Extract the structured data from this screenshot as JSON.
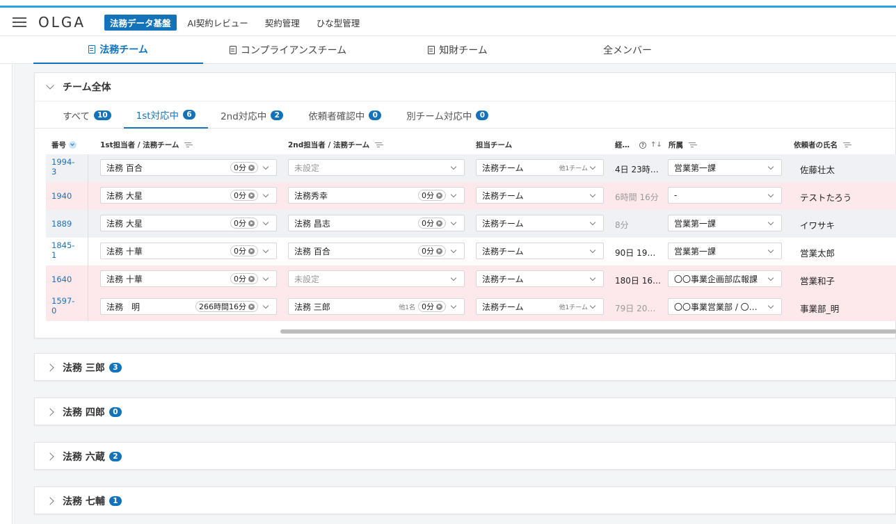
{
  "header": {
    "logo": "OLGA",
    "nav": [
      "法務データ基盤",
      "AI契約レビュー",
      "契約管理",
      "ひな型管理"
    ],
    "active_nav": 0
  },
  "team_tabs": [
    "法務チーム",
    "コンプライアンスチーム",
    "知財チーム",
    "全メンバー"
  ],
  "main_panel": {
    "title": "チーム全体",
    "status_tabs": [
      {
        "label": "すべて",
        "count": "10"
      },
      {
        "label": "1st対応中",
        "count": "6"
      },
      {
        "label": "2nd対応中",
        "count": "2"
      },
      {
        "label": "依頼者確認中",
        "count": "0"
      },
      {
        "label": "別チーム対応中",
        "count": "0"
      }
    ],
    "columns": {
      "id": "番号",
      "first": "1st担当者 / 法務チーム",
      "second": "2nd担当者 / 法務チーム",
      "team": "担当チーム",
      "elapsed": "経…",
      "dept": "所属",
      "requester": "依頼者の氏名"
    },
    "rows": [
      {
        "id": "1994-\n3",
        "first": "法務 百合",
        "first_time": "0分",
        "second": "未設定",
        "second_time": "",
        "second_extra": "",
        "team": "法務チーム",
        "team_extra": "他1チーム",
        "elapsed": "4日 23時…",
        "dept": "営業第一課",
        "requester": "佐藤壮太"
      },
      {
        "id": "1940",
        "first": "法務 大星",
        "first_time": "0分",
        "second": "法務秀幸",
        "second_time": "0分",
        "second_extra": "",
        "team": "法務チーム",
        "team_extra": "",
        "elapsed": "6時間 16分",
        "dept": "-",
        "requester": "テストたろう"
      },
      {
        "id": "1889",
        "first": "法務 大星",
        "first_time": "0分",
        "second": "法務 昌志",
        "second_time": "0分",
        "second_extra": "",
        "team": "法務チーム",
        "team_extra": "",
        "elapsed": "8分",
        "dept": "営業第一課",
        "requester": "イワサキ"
      },
      {
        "id": "1845-\n1",
        "first": "法務 十華",
        "first_time": "0分",
        "second": "法務 百合",
        "second_time": "0分",
        "second_extra": "",
        "team": "法務チーム",
        "team_extra": "",
        "elapsed": "90日 19…",
        "dept": "営業第一課",
        "requester": "営業太郎"
      },
      {
        "id": "1640",
        "first": "法務 十華",
        "first_time": "0分",
        "second": "未設定",
        "second_time": "",
        "second_extra": "",
        "team": "法務チーム",
        "team_extra": "",
        "elapsed": "180日 16…",
        "dept": "〇〇事業企画部広報課",
        "requester": "営業和子"
      },
      {
        "id": "1597-\n0",
        "first": "法務　明",
        "first_time": "266時間16分",
        "second": "法務 三郎",
        "second_time": "0分",
        "second_extra": "他1名",
        "team": "法務チーム",
        "team_extra": "他1チーム",
        "elapsed": "79日 20…",
        "dept": "〇〇事業営業部 / 〇…",
        "requester": "事業部_明"
      }
    ]
  },
  "collapsed_panels": [
    {
      "title": "法務 三郎",
      "count": "3"
    },
    {
      "title": "法務 四郎",
      "count": "0"
    },
    {
      "title": "法務 六蔵",
      "count": "2"
    },
    {
      "title": "法務 七輔",
      "count": "1"
    }
  ]
}
